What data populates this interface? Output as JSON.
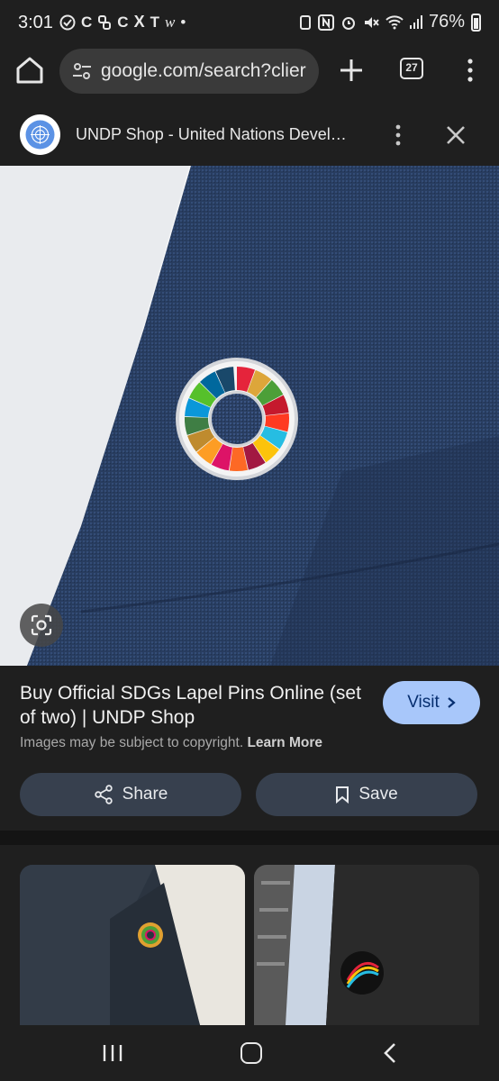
{
  "status_bar": {
    "time": "3:01",
    "left_icons": [
      "C",
      "X",
      "T",
      "w",
      "•"
    ],
    "battery": "76%"
  },
  "browser": {
    "url": "google.com/search?clier",
    "tab_count": "27"
  },
  "source": {
    "title": "UNDP Shop - United Nations Devel…"
  },
  "result": {
    "title": "Buy Official SDGs Lapel Pins Online (set of two) | UNDP Shop",
    "visit_label": "Visit",
    "copyright_text": "Images may be subject to copyright.",
    "learn_more_label": "Learn More",
    "share_label": "Share",
    "save_label": "Save"
  },
  "colors": {
    "accent": "#a8c7fa",
    "button_bg": "#37404e",
    "background": "#1f1f1f"
  },
  "icons": [
    "home-icon",
    "tune-icon",
    "plus-icon",
    "tabs-icon",
    "more-vert-icon",
    "close-icon",
    "lens-icon",
    "chevron-right-icon",
    "share-icon",
    "bookmark-icon",
    "recents-icon",
    "nav-home-icon",
    "back-icon"
  ]
}
